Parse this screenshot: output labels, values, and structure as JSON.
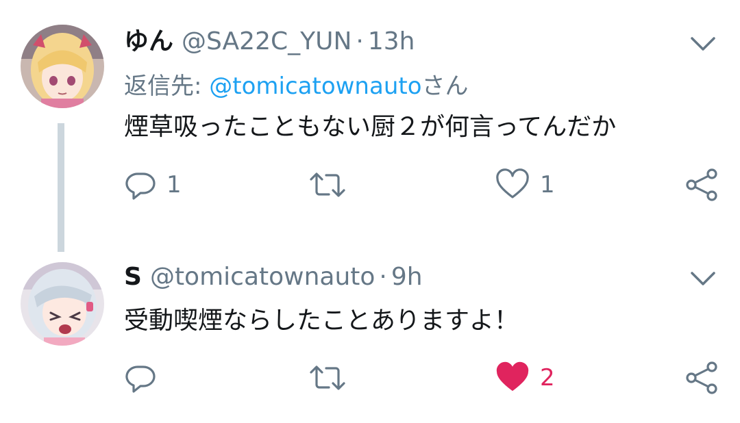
{
  "tweets": [
    {
      "display_name": "ゆん",
      "handle": "@SA22C_YUN",
      "separator": "·",
      "time": "13h",
      "reply_prefix": "返信先: ",
      "reply_handle": "@tomicatownauto",
      "reply_suffix": "さん",
      "text": "煙草吸ったこともない厨２が何言ってんだか",
      "reply_count": "1",
      "retweet_count": "",
      "like_count": "1",
      "liked": false,
      "avatar_icon": "avatar-blonde-anime-girl"
    },
    {
      "display_name": "S",
      "handle": "@tomicatownauto",
      "separator": "·",
      "time": "9h",
      "text": "受動喫煙ならしたことありますよ！",
      "reply_count": "",
      "retweet_count": "",
      "like_count": "2",
      "liked": true,
      "avatar_icon": "avatar-silver-hair-anime-girl"
    }
  ],
  "icons": {
    "reply": "reply-icon",
    "retweet": "retweet-icon",
    "like": "heart-icon",
    "share": "share-icon",
    "caret": "chevron-down-icon"
  },
  "colors": {
    "text": "#14171a",
    "muted": "#657786",
    "link": "#1da1f2",
    "like_active": "#e0245e",
    "thread_line": "#ccd6dd"
  }
}
